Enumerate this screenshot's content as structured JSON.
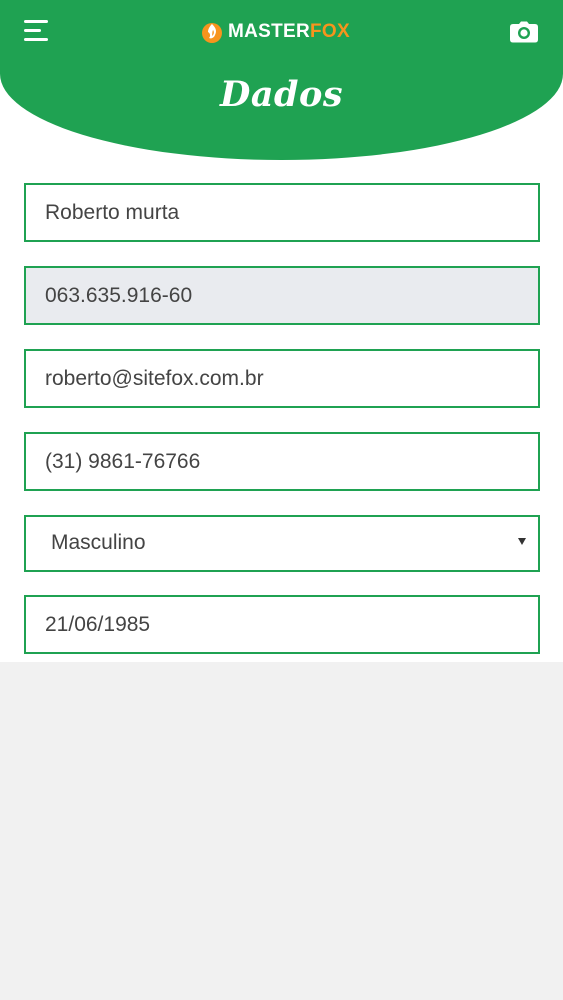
{
  "header": {
    "logo_master": "MASTER",
    "logo_fox": "FOX",
    "page_title": "Dados"
  },
  "form": {
    "name": "Roberto murta",
    "cpf": "063.635.916-60",
    "email": "roberto@sitefox.com.br",
    "phone": "(31) 9861-76766",
    "gender": "Masculino",
    "birth_date": "21/06/1985"
  },
  "colors": {
    "brand_green": "#1fa252",
    "logo_orange": "#f7941d",
    "readonly_bg": "#e9ebef"
  },
  "icons": {
    "menu": "hamburger-menu-icon",
    "logo": "flame-icon",
    "camera": "camera-icon",
    "select": "caret-down-icon"
  }
}
